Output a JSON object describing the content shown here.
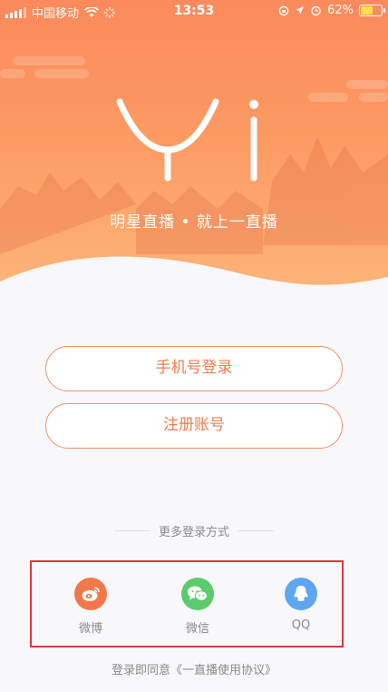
{
  "status_bar": {
    "carrier": "中国移动",
    "time": "13:53",
    "battery": "62%",
    "battery_level": 0.62,
    "battery_color": "#fde04a"
  },
  "hero": {
    "logo_name": "yi-logo",
    "slogan": "明星直播 • 就上一直播",
    "gradient_top": "#fb8a5c",
    "gradient_bottom": "#fdb67a"
  },
  "buttons": {
    "phone_login": "手机号登录",
    "register": "注册账号",
    "accent": "#f07d52"
  },
  "more_methods": {
    "title": "更多登录方式",
    "items": [
      {
        "label": "微博",
        "icon": "weibo-icon",
        "color": "#f2784b"
      },
      {
        "label": "微信",
        "icon": "wechat-icon",
        "color": "#5bcb6b"
      },
      {
        "label": "QQ",
        "icon": "qq-icon",
        "color": "#5ea7f0"
      }
    ]
  },
  "agreement": "登录即同意《一直播使用协议》"
}
